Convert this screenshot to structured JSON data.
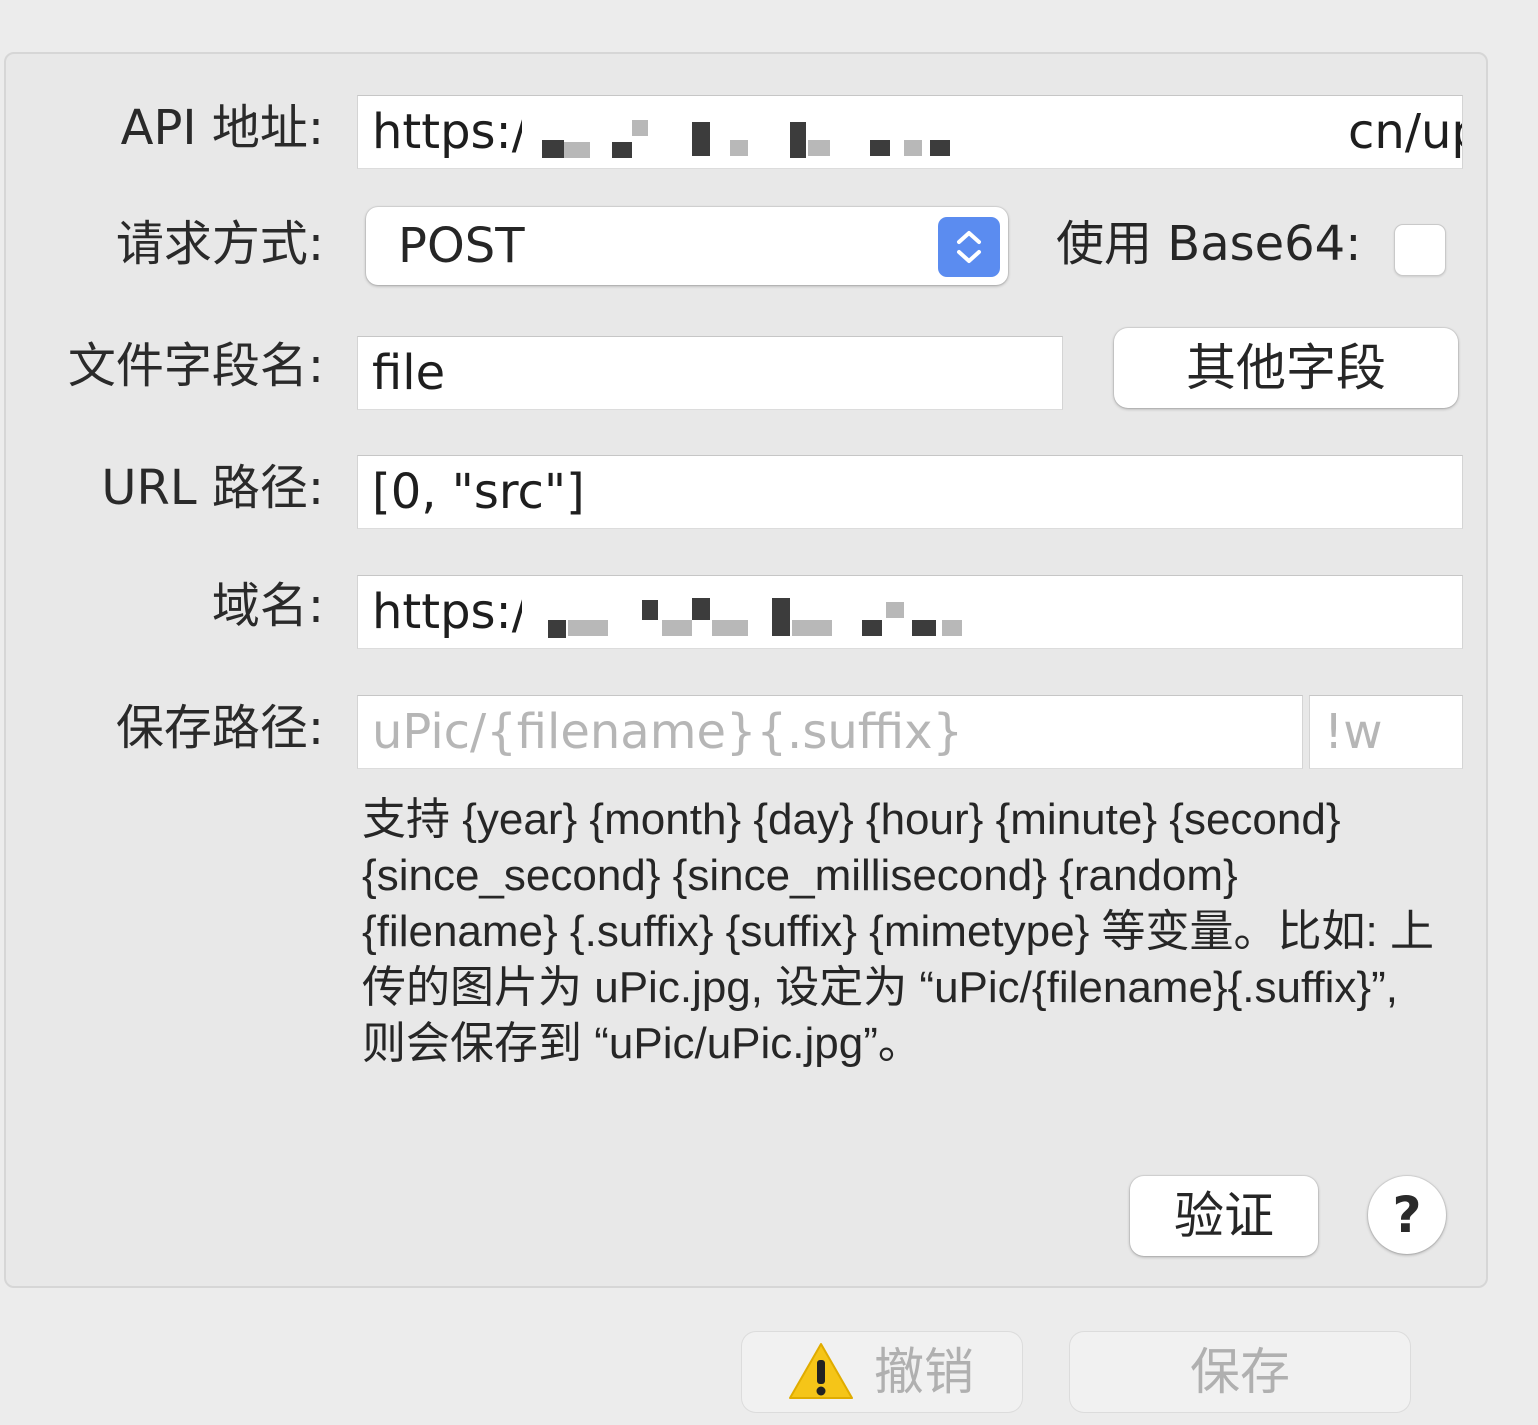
{
  "form": {
    "api_label": "API 地址:",
    "api_value": "https://",
    "api_value_tail": "cn/upload",
    "method_label": "请求方式:",
    "method_value": "POST",
    "base64_label": "使用 Base64:",
    "base64_checked": false,
    "file_field_label": "文件字段名:",
    "file_field_value": "file",
    "other_fields_button": "其他字段",
    "url_path_label": "URL 路径:",
    "url_path_value": "[0, \"src\"]",
    "domain_label": "域名:",
    "domain_value": "https://",
    "save_path_label": "保存路径:",
    "save_path_placeholder": "uPic/{filename}{.suffix}",
    "suffix_placeholder": "!w",
    "hint": "支持 {year} {month} {day} {hour} {minute} {second} {since_second} {since_millisecond} {random} {filename} {.suffix} {suffix} {mimetype} 等变量。比如: 上传的图片为 uPic.jpg, 设定为 “uPic/{filename}{.suffix}”, 则会保存到 “uPic/uPic.jpg”。",
    "verify_button": "验证",
    "help_button": "?"
  },
  "footer": {
    "cancel_button": "撤销",
    "save_button": "保存"
  },
  "colors": {
    "accent": "#5b8cf0",
    "warning": "#f5c518"
  },
  "icons": {
    "stepper": "chevron-up-down-icon",
    "warning": "warning-icon"
  }
}
